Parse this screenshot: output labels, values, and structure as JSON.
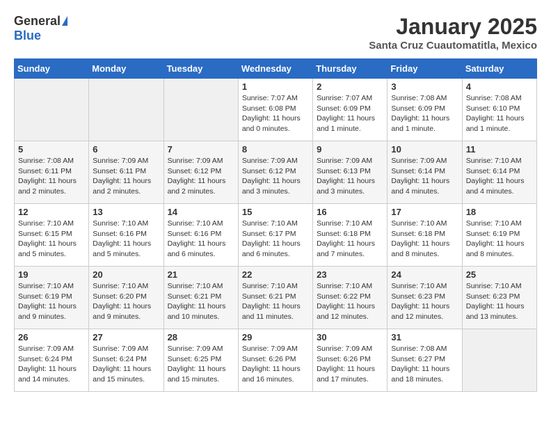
{
  "header": {
    "logo_general": "General",
    "logo_blue": "Blue",
    "title": "January 2025",
    "subtitle": "Santa Cruz Cuautomatitla, Mexico"
  },
  "days_of_week": [
    "Sunday",
    "Monday",
    "Tuesday",
    "Wednesday",
    "Thursday",
    "Friday",
    "Saturday"
  ],
  "weeks": [
    [
      {
        "day": "",
        "info": ""
      },
      {
        "day": "",
        "info": ""
      },
      {
        "day": "",
        "info": ""
      },
      {
        "day": "1",
        "info": "Sunrise: 7:07 AM\nSunset: 6:08 PM\nDaylight: 11 hours\nand 0 minutes."
      },
      {
        "day": "2",
        "info": "Sunrise: 7:07 AM\nSunset: 6:09 PM\nDaylight: 11 hours\nand 1 minute."
      },
      {
        "day": "3",
        "info": "Sunrise: 7:08 AM\nSunset: 6:09 PM\nDaylight: 11 hours\nand 1 minute."
      },
      {
        "day": "4",
        "info": "Sunrise: 7:08 AM\nSunset: 6:10 PM\nDaylight: 11 hours\nand 1 minute."
      }
    ],
    [
      {
        "day": "5",
        "info": "Sunrise: 7:08 AM\nSunset: 6:11 PM\nDaylight: 11 hours\nand 2 minutes."
      },
      {
        "day": "6",
        "info": "Sunrise: 7:09 AM\nSunset: 6:11 PM\nDaylight: 11 hours\nand 2 minutes."
      },
      {
        "day": "7",
        "info": "Sunrise: 7:09 AM\nSunset: 6:12 PM\nDaylight: 11 hours\nand 2 minutes."
      },
      {
        "day": "8",
        "info": "Sunrise: 7:09 AM\nSunset: 6:12 PM\nDaylight: 11 hours\nand 3 minutes."
      },
      {
        "day": "9",
        "info": "Sunrise: 7:09 AM\nSunset: 6:13 PM\nDaylight: 11 hours\nand 3 minutes."
      },
      {
        "day": "10",
        "info": "Sunrise: 7:09 AM\nSunset: 6:14 PM\nDaylight: 11 hours\nand 4 minutes."
      },
      {
        "day": "11",
        "info": "Sunrise: 7:10 AM\nSunset: 6:14 PM\nDaylight: 11 hours\nand 4 minutes."
      }
    ],
    [
      {
        "day": "12",
        "info": "Sunrise: 7:10 AM\nSunset: 6:15 PM\nDaylight: 11 hours\nand 5 minutes."
      },
      {
        "day": "13",
        "info": "Sunrise: 7:10 AM\nSunset: 6:16 PM\nDaylight: 11 hours\nand 5 minutes."
      },
      {
        "day": "14",
        "info": "Sunrise: 7:10 AM\nSunset: 6:16 PM\nDaylight: 11 hours\nand 6 minutes."
      },
      {
        "day": "15",
        "info": "Sunrise: 7:10 AM\nSunset: 6:17 PM\nDaylight: 11 hours\nand 6 minutes."
      },
      {
        "day": "16",
        "info": "Sunrise: 7:10 AM\nSunset: 6:18 PM\nDaylight: 11 hours\nand 7 minutes."
      },
      {
        "day": "17",
        "info": "Sunrise: 7:10 AM\nSunset: 6:18 PM\nDaylight: 11 hours\nand 8 minutes."
      },
      {
        "day": "18",
        "info": "Sunrise: 7:10 AM\nSunset: 6:19 PM\nDaylight: 11 hours\nand 8 minutes."
      }
    ],
    [
      {
        "day": "19",
        "info": "Sunrise: 7:10 AM\nSunset: 6:19 PM\nDaylight: 11 hours\nand 9 minutes."
      },
      {
        "day": "20",
        "info": "Sunrise: 7:10 AM\nSunset: 6:20 PM\nDaylight: 11 hours\nand 9 minutes."
      },
      {
        "day": "21",
        "info": "Sunrise: 7:10 AM\nSunset: 6:21 PM\nDaylight: 11 hours\nand 10 minutes."
      },
      {
        "day": "22",
        "info": "Sunrise: 7:10 AM\nSunset: 6:21 PM\nDaylight: 11 hours\nand 11 minutes."
      },
      {
        "day": "23",
        "info": "Sunrise: 7:10 AM\nSunset: 6:22 PM\nDaylight: 11 hours\nand 12 minutes."
      },
      {
        "day": "24",
        "info": "Sunrise: 7:10 AM\nSunset: 6:23 PM\nDaylight: 11 hours\nand 12 minutes."
      },
      {
        "day": "25",
        "info": "Sunrise: 7:10 AM\nSunset: 6:23 PM\nDaylight: 11 hours\nand 13 minutes."
      }
    ],
    [
      {
        "day": "26",
        "info": "Sunrise: 7:09 AM\nSunset: 6:24 PM\nDaylight: 11 hours\nand 14 minutes."
      },
      {
        "day": "27",
        "info": "Sunrise: 7:09 AM\nSunset: 6:24 PM\nDaylight: 11 hours\nand 15 minutes."
      },
      {
        "day": "28",
        "info": "Sunrise: 7:09 AM\nSunset: 6:25 PM\nDaylight: 11 hours\nand 15 minutes."
      },
      {
        "day": "29",
        "info": "Sunrise: 7:09 AM\nSunset: 6:26 PM\nDaylight: 11 hours\nand 16 minutes."
      },
      {
        "day": "30",
        "info": "Sunrise: 7:09 AM\nSunset: 6:26 PM\nDaylight: 11 hours\nand 17 minutes."
      },
      {
        "day": "31",
        "info": "Sunrise: 7:08 AM\nSunset: 6:27 PM\nDaylight: 11 hours\nand 18 minutes."
      },
      {
        "day": "",
        "info": ""
      }
    ]
  ]
}
